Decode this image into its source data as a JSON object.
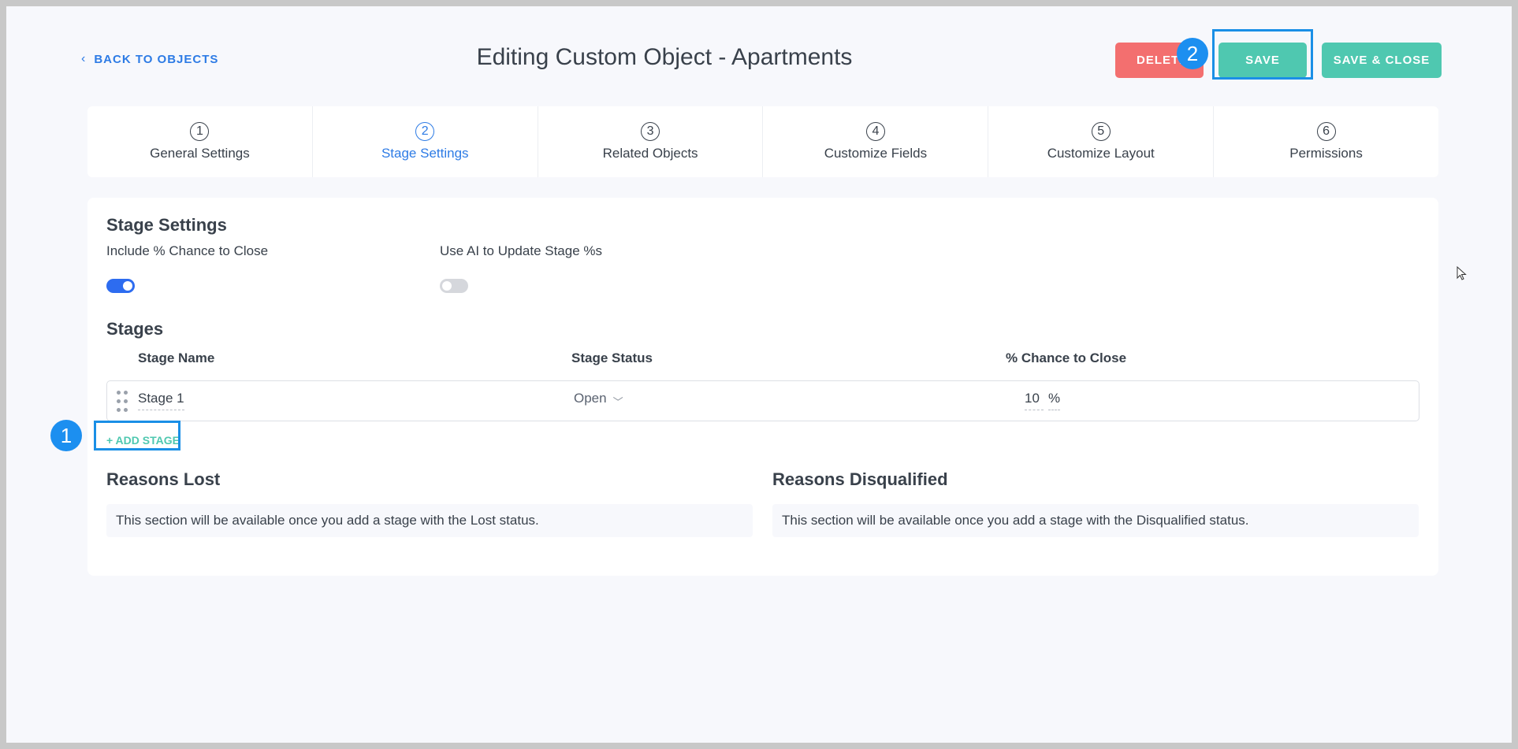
{
  "header": {
    "back_label": "BACK TO OBJECTS",
    "title": "Editing Custom Object - Apartments",
    "delete_label": "DELETE",
    "save_label": "SAVE",
    "save_close_label": "SAVE & CLOSE"
  },
  "badges": {
    "one": "1",
    "two": "2"
  },
  "steps": [
    {
      "num": "1",
      "label": "General Settings"
    },
    {
      "num": "2",
      "label": "Stage Settings"
    },
    {
      "num": "3",
      "label": "Related Objects"
    },
    {
      "num": "4",
      "label": "Customize Fields"
    },
    {
      "num": "5",
      "label": "Customize Layout"
    },
    {
      "num": "6",
      "label": "Permissions"
    }
  ],
  "stage_settings": {
    "title": "Stage Settings",
    "include_chance_label": "Include % Chance to Close",
    "include_chance_on": true,
    "use_ai_label": "Use AI to Update Stage %s",
    "use_ai_on": false
  },
  "stages": {
    "title": "Stages",
    "col_name": "Stage Name",
    "col_status": "Stage Status",
    "col_chance": "% Chance to Close",
    "rows": [
      {
        "name": "Stage 1",
        "status": "Open",
        "chance": "10",
        "unit": "%"
      }
    ],
    "add_label": "+ ADD STAGE"
  },
  "reasons_lost": {
    "title": "Reasons Lost",
    "message": "This section will be available once you add a stage with the Lost status."
  },
  "reasons_disqualified": {
    "title": "Reasons Disqualified",
    "message": "This section will be available once you add a stage with the Disqualified status."
  },
  "colors": {
    "accent_blue": "#2d7be5",
    "teal": "#4fc8b0",
    "delete_red": "#f36f6f",
    "highlight": "#1a8fe6"
  }
}
